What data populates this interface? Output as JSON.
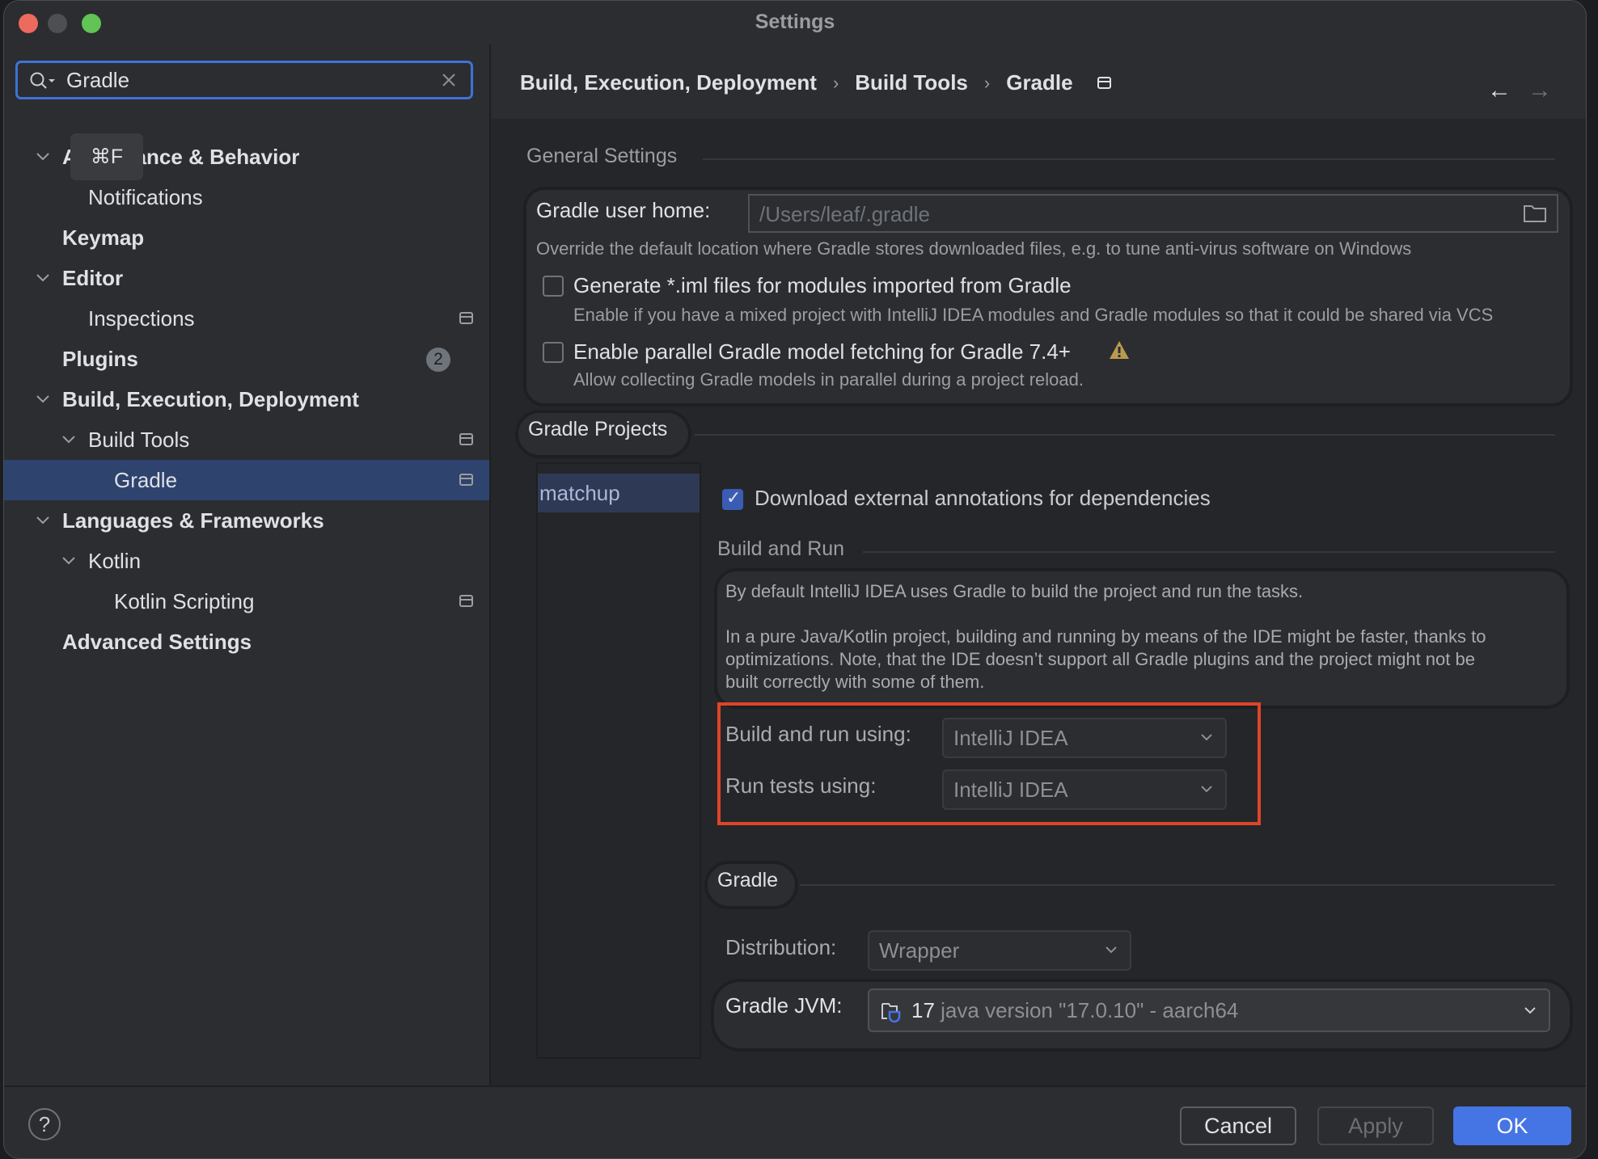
{
  "window": {
    "title": "Settings"
  },
  "search": {
    "value": "Gradle",
    "shortcut_tooltip": "⌘F"
  },
  "sidebar": {
    "items": [
      {
        "label": "Appearance & Behavior",
        "level": 0,
        "expanded": true,
        "bold": true
      },
      {
        "label": "Notifications",
        "level": 1
      },
      {
        "label": "Keymap",
        "level": 0,
        "bold": true
      },
      {
        "label": "Editor",
        "level": 0,
        "expanded": true,
        "bold": true
      },
      {
        "label": "Inspections",
        "level": 1,
        "icon": "project-settings-icon"
      },
      {
        "label": "Plugins",
        "level": 0,
        "bold": true,
        "badge": "2"
      },
      {
        "label": "Build, Execution, Deployment",
        "level": 0,
        "expanded": true,
        "bold": true
      },
      {
        "label": "Build Tools",
        "level": 1,
        "expanded": true,
        "icon": "project-settings-icon"
      },
      {
        "label": "Gradle",
        "level": 2,
        "selected": true,
        "icon": "project-settings-icon"
      },
      {
        "label": "Languages & Frameworks",
        "level": 0,
        "expanded": true,
        "bold": true
      },
      {
        "label": "Kotlin",
        "level": 1,
        "expanded": true
      },
      {
        "label": "Kotlin Scripting",
        "level": 2,
        "icon": "project-settings-icon"
      },
      {
        "label": "Advanced Settings",
        "level": 0,
        "bold": true
      }
    ]
  },
  "breadcrumb": {
    "items": [
      "Build, Execution, Deployment",
      "Build Tools",
      "Gradle"
    ],
    "separator": "›"
  },
  "nav": {
    "back": "←",
    "forward": "→"
  },
  "general": {
    "section_title": "General Settings",
    "user_home_label": "Gradle user home:",
    "user_home_placeholder": "/Users/leaf/.gradle",
    "user_home_hint": "Override the default location where Gradle stores downloaded files, e.g. to tune anti-virus software on Windows",
    "generate_iml_label": "Generate *.iml files for modules imported from Gradle",
    "generate_iml_checked": false,
    "generate_iml_hint": "Enable if you have a mixed project with IntelliJ IDEA modules and Gradle modules so that it could be shared via VCS",
    "parallel_label": "Enable parallel Gradle model fetching for Gradle 7.4+",
    "parallel_checked": false,
    "parallel_hint": "Allow collecting Gradle models in parallel during a project reload."
  },
  "projects": {
    "section_title": "Gradle Projects",
    "list": [
      "matchup"
    ],
    "download_annotations_label": "Download external annotations for dependencies",
    "download_annotations_checked": true
  },
  "build_and_run": {
    "section_title": "Build and Run",
    "desc_1": "By default IntelliJ IDEA uses Gradle to build the project and run the tasks.",
    "desc_2a": "In a pure Java/Kotlin project, building and running by means of the IDE might be faster, thanks to",
    "desc_2b": "optimizations. Note, that the IDE doesn’t support all Gradle plugins and the project might not be",
    "desc_2c": "built correctly with some of them.",
    "build_run_label": "Build and run using:",
    "build_run_value": "IntelliJ IDEA",
    "run_tests_label": "Run tests using:",
    "run_tests_value": "IntelliJ IDEA"
  },
  "gradle": {
    "section_title": "Gradle",
    "distribution_label": "Distribution:",
    "distribution_value": "Wrapper",
    "jvm_label": "Gradle JVM:",
    "jvm_version": "17",
    "jvm_detail": "java version \"17.0.10\" - aarch64"
  },
  "footer": {
    "help": "?",
    "cancel": "Cancel",
    "apply": "Apply",
    "ok": "OK"
  },
  "colors": {
    "accent": "#4574e4",
    "selection": "#2e436e",
    "highlight_box": "#e04428",
    "warning": "#b99a4f"
  }
}
